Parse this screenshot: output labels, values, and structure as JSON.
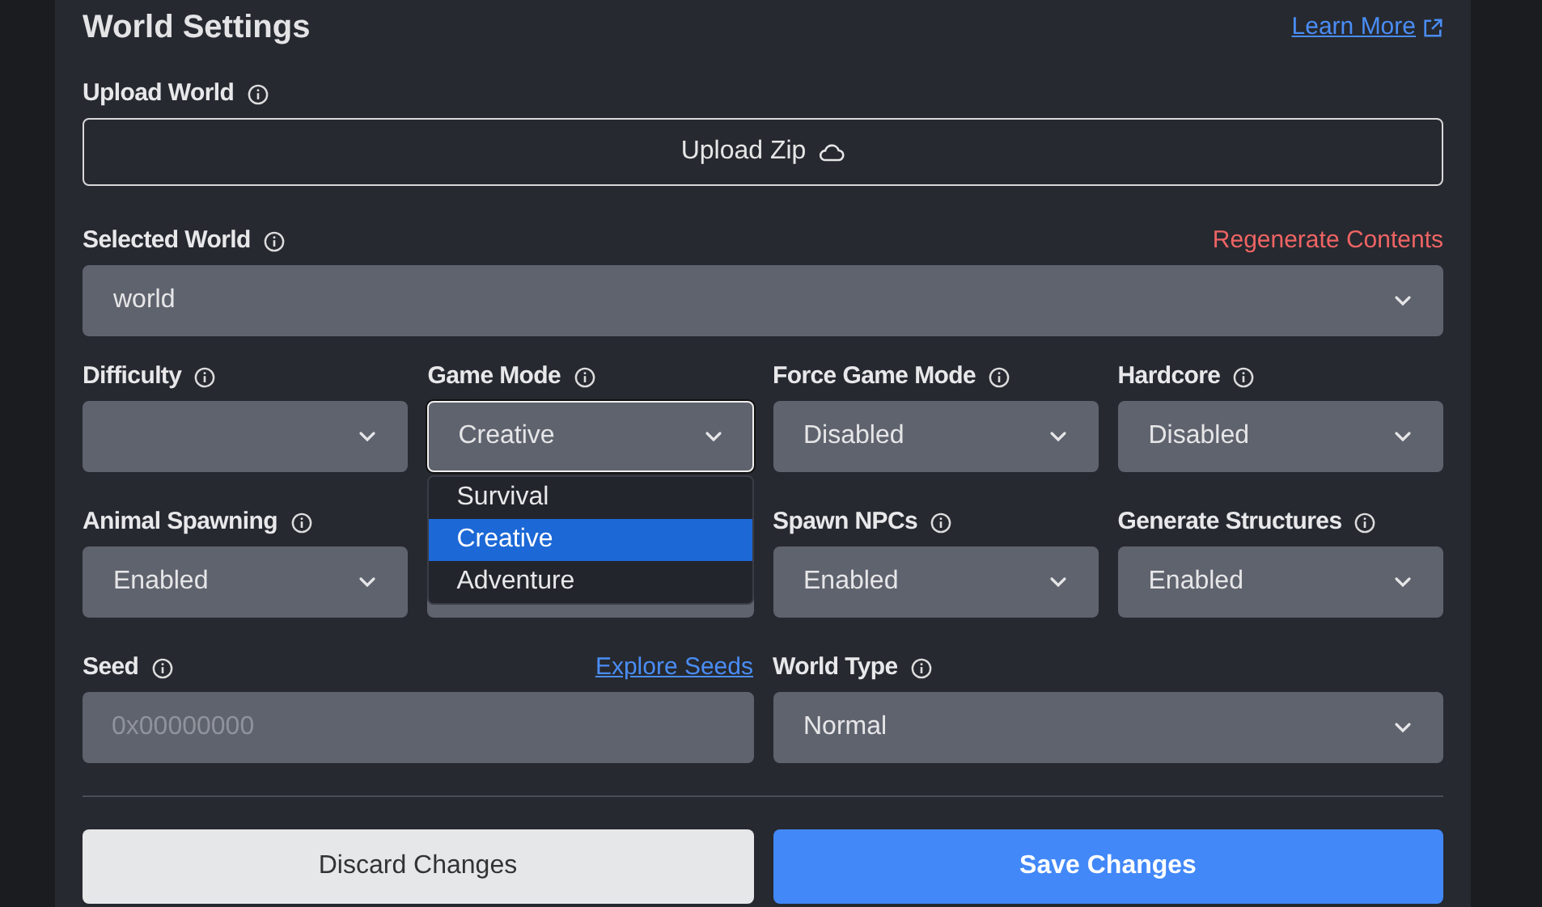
{
  "title": "World Settings",
  "learn_more": "Learn More",
  "upload": {
    "label": "Upload World",
    "button": "Upload Zip"
  },
  "selected_world": {
    "label": "Selected World",
    "action": "Regenerate Contents",
    "value": "world"
  },
  "fields": [
    {
      "kind": "select",
      "label": "Difficulty"
    },
    {
      "kind": "select",
      "label": "Game Mode",
      "value": "Creative",
      "open": true,
      "options": [
        {
          "label": "Survival",
          "selected": false
        },
        {
          "label": "Creative",
          "selected": true
        },
        {
          "label": "Adventure",
          "selected": false
        }
      ]
    },
    {
      "kind": "select",
      "label": "Force Game Mode",
      "value": "Disabled"
    },
    {
      "kind": "select",
      "label": "Hardcore",
      "value": "Disabled"
    },
    {
      "kind": "select",
      "label": "Animal Spawning",
      "value": "Enabled"
    },
    {
      "kind": "select"
    },
    {
      "kind": "select",
      "label": "Spawn NPCs",
      "value": "Enabled"
    },
    {
      "kind": "select",
      "label": "Generate Structures",
      "value": "Enabled"
    },
    {
      "kind": "input",
      "label": "Seed",
      "link": "Explore Seeds",
      "placeholder": "0x00000000",
      "wide": true
    },
    {
      "kind": "select",
      "label": "World Type",
      "value": "Normal",
      "wide": true
    }
  ],
  "buttons": [
    {
      "label": "Discard Changes",
      "kind": "secondary"
    },
    {
      "label": "Save Changes",
      "kind": "primary"
    }
  ]
}
